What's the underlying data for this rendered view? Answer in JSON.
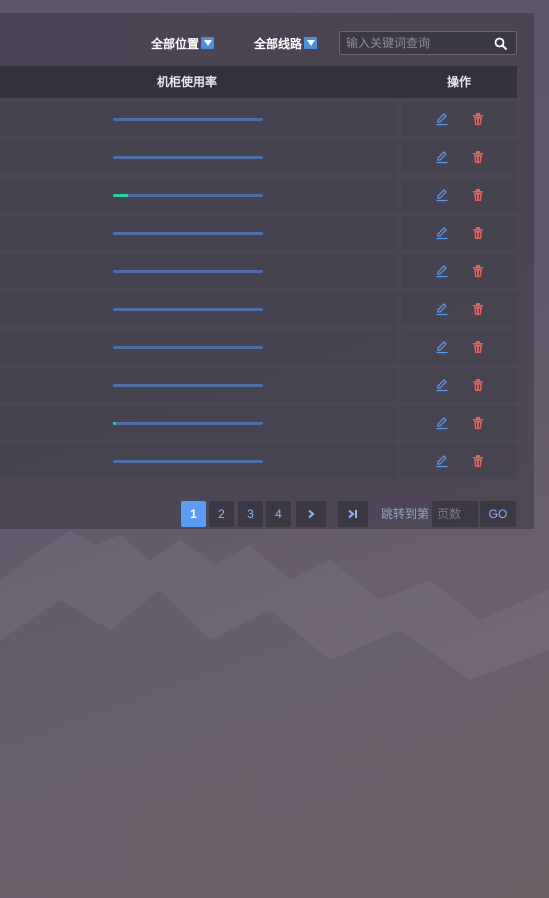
{
  "toolbar": {
    "location_filter": "全部位置",
    "line_filter": "全部线路",
    "search_placeholder": "输入关键词查询"
  },
  "table": {
    "headers": {
      "usage": "机柜使用率",
      "actions": "操作"
    },
    "rows": [
      {
        "usage": 0.0
      },
      {
        "usage": 0.0
      },
      {
        "usage": 0.1
      },
      {
        "usage": 0.0
      },
      {
        "usage": 0.0
      },
      {
        "usage": 0.0
      },
      {
        "usage": 0.0
      },
      {
        "usage": 0.0
      },
      {
        "usage": 0.02
      },
      {
        "usage": 0.0
      }
    ]
  },
  "pagination": {
    "pages": [
      "1",
      "2",
      "3",
      "4"
    ],
    "current": "1",
    "jump_label": "跳转到第",
    "page_placeholder": "页数",
    "go_label": "GO"
  },
  "colors": {
    "accent": "#5b9cf5",
    "usage_fill": "#1fd8a0",
    "usage_track": "#4e6ea8",
    "edit_icon": "#5b9cf5",
    "delete_icon": "#e0635c"
  },
  "icons": {
    "filter_caret": "chevron-down-icon",
    "search": "search-icon",
    "edit": "edit-icon",
    "delete": "trash-icon",
    "next": "chevron-right-icon",
    "last": "last-page-icon"
  }
}
